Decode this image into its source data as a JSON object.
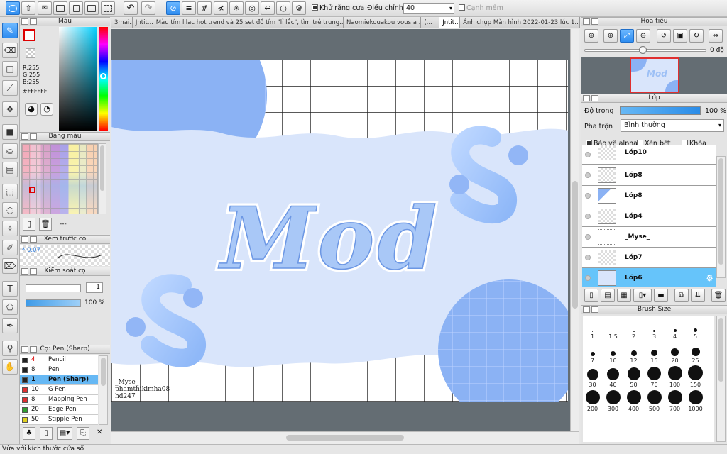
{
  "toolbar": {
    "antialias_label": "Khử răng cưa",
    "adjust_label": "Điều chỉnh",
    "adjust_value": "40",
    "smooth_label": "Cạnh mềm"
  },
  "tabs": [
    "3mai...",
    "Jntit...",
    "Màu tím lilac hot trend và 25 set đồ tím \"lỉ lắc\", tìm trẻ trung...",
    "Naomiekouakou vous a ...",
    "(...",
    "Jntit...",
    "Ảnh chụp Màn hình 2022-01-23 lúc 1..."
  ],
  "color_panel": {
    "title": "Màu",
    "r": "R:255",
    "g": "G:255",
    "b": "B:255",
    "hex": "#FFFFFF"
  },
  "palette_panel": {
    "title": "Bảng màu",
    "dash": "---"
  },
  "brush_preview": {
    "title": "Xem trước cọ",
    "size": "* 0.07"
  },
  "brush_control": {
    "title": "Kiểm soát cọ",
    "size": "1",
    "opacity": "100 %"
  },
  "brush_list": {
    "title": "Cọ: Pen (Sharp)",
    "items": [
      {
        "size": "4",
        "name": "Pencil",
        "color": "#222222"
      },
      {
        "size": "8",
        "name": "Pen",
        "color": "#222222"
      },
      {
        "size": "1",
        "name": "Pen (Sharp)",
        "color": "#222222"
      },
      {
        "size": "10",
        "name": "G Pen",
        "color": "#e03030"
      },
      {
        "size": "8",
        "name": "Mapping Pen",
        "color": "#e03030"
      },
      {
        "size": "20",
        "name": "Edge Pen",
        "color": "#30a030"
      },
      {
        "size": "50",
        "name": "Stipple Pen",
        "color": "#e0d020"
      }
    ]
  },
  "canvas": {
    "title": "Mod",
    "credit_line1": "_Myse_",
    "credit_line2": "phamthikimha08",
    "credit_line3": "hd247"
  },
  "navigator": {
    "title": "Hoa tiêu",
    "angle": "0 độ"
  },
  "layers": {
    "title": "Lớp",
    "opacity_label": "Độ trong",
    "opacity_value": "100 %",
    "blend_label": "Pha trộn",
    "blend_value": "Bình thường",
    "protect_alpha": "Bảo vệ alpha",
    "clip": "Xén bớt",
    "lock": "Khóa",
    "items": [
      "Lớp10",
      "Lớp8",
      "Lớp8",
      "Lớp4",
      "_Myse_",
      "Lớp7",
      "Lớp6"
    ]
  },
  "brush_size": {
    "title": "Brush Size",
    "sizes": [
      "1",
      "1.5",
      "2",
      "3",
      "4",
      "5",
      "7",
      "10",
      "12",
      "15",
      "20",
      "25",
      "30",
      "40",
      "50",
      "70",
      "100",
      "150",
      "200",
      "300",
      "400",
      "500",
      "700",
      "1000"
    ]
  },
  "status": {
    "text": "Vừa với kích thước cửa sổ"
  }
}
